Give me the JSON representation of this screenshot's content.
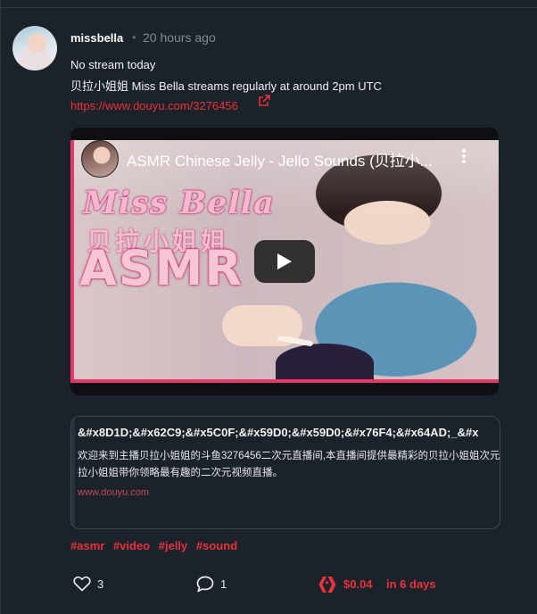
{
  "post": {
    "author": "missbella",
    "separator": "•",
    "timestamp": "20 hours ago",
    "line1": "No stream today",
    "line2": "贝拉小姐姐 Miss Bella streams regularly at around 2pm UTC",
    "link": "https://www.douyu.com/3276456"
  },
  "video": {
    "title": "ASMR Chinese Jelly - Jello Sounds (贝拉小...",
    "overlay": {
      "brand": "Miss Bella",
      "brand_cn": "贝拉小姐姐",
      "brand_asmr": "ASMR"
    }
  },
  "link_card": {
    "title": "&#x8D1D;&#x62C9;&#x5C0F;&#x59D0;&#x59D0;&#x76F4;&#x64AD;_&#x",
    "description": "欢迎来到主播贝拉小姐姐的斗鱼3276456二次元直播间,本直播间提供最精彩的贝拉小姐姐次元直播,贝拉小姐姐带你领略最有趣的二次元视频直播。",
    "domain": "www.douyu.com"
  },
  "tags": [
    "#asmr",
    "#video",
    "#jelly",
    "#sound"
  ],
  "actions": {
    "likes": "3",
    "comments": "1",
    "payout": "$0.04",
    "payout_time": "in 6 days"
  },
  "colors": {
    "background": "#1b222a",
    "accent": "#e8323c",
    "muted": "#808b96"
  },
  "icons": {
    "external_link": "external-link-icon",
    "like": "heart-icon",
    "comment": "comment-icon",
    "payout": "hive-icon",
    "video_menu": "more-vertical-icon",
    "play": "play-icon"
  }
}
